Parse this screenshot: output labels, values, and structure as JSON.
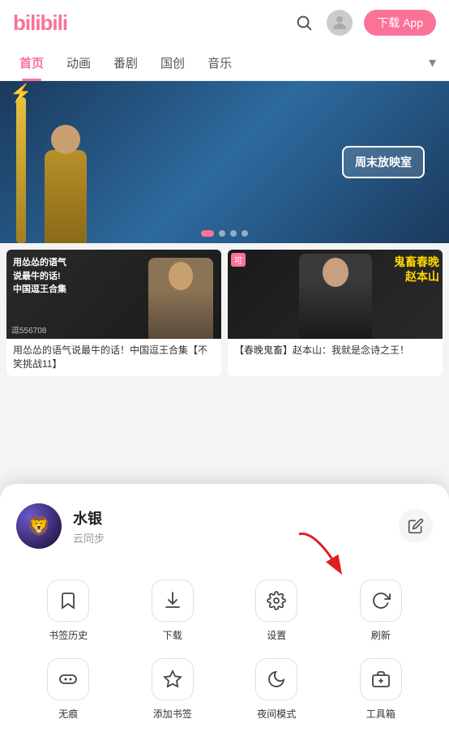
{
  "header": {
    "logo": "bilibili",
    "download_label": "下载 App",
    "search_aria": "搜索",
    "avatar_aria": "用户头像"
  },
  "nav": {
    "tabs": [
      "首页",
      "动画",
      "番剧",
      "国创",
      "音乐"
    ],
    "active_index": 0,
    "more_label": "▾"
  },
  "banner": {
    "cinema_label": "周末放映室",
    "dots": 4,
    "active_dot": 0
  },
  "videos": [
    {
      "title": "用怂怂的语气说最牛的话！中国逗王合集【不笑挑战11】",
      "play_count": "逗556708",
      "text_overlay": "用怂怂的语气\n说最牛的话!\n中国逗王合集"
    },
    {
      "title": "【春晚鬼畜】赵本山：我就是念诗之王！",
      "red_badge": "可",
      "yellow_text": "鬼畜春晚\n赵本山"
    }
  ],
  "bottom_sheet": {
    "user": {
      "name": "水银",
      "subtitle": "云同步",
      "avatar_emoji": "🦁"
    },
    "menu_row1": [
      {
        "icon": "🔖",
        "label": "书签历史",
        "name": "bookmark-history"
      },
      {
        "icon": "⬇",
        "label": "下载",
        "name": "download"
      },
      {
        "icon": "⚙",
        "label": "设置",
        "name": "settings"
      },
      {
        "icon": "↺",
        "label": "刷新",
        "name": "refresh"
      }
    ],
    "menu_row2": [
      {
        "icon": "👻",
        "label": "无痕",
        "name": "incognito"
      },
      {
        "icon": "☆",
        "label": "添加书签",
        "name": "add-bookmark"
      },
      {
        "icon": "🌙",
        "label": "夜间模式",
        "name": "night-mode"
      },
      {
        "icon": "🧰",
        "label": "工具箱",
        "name": "toolbox"
      }
    ]
  }
}
